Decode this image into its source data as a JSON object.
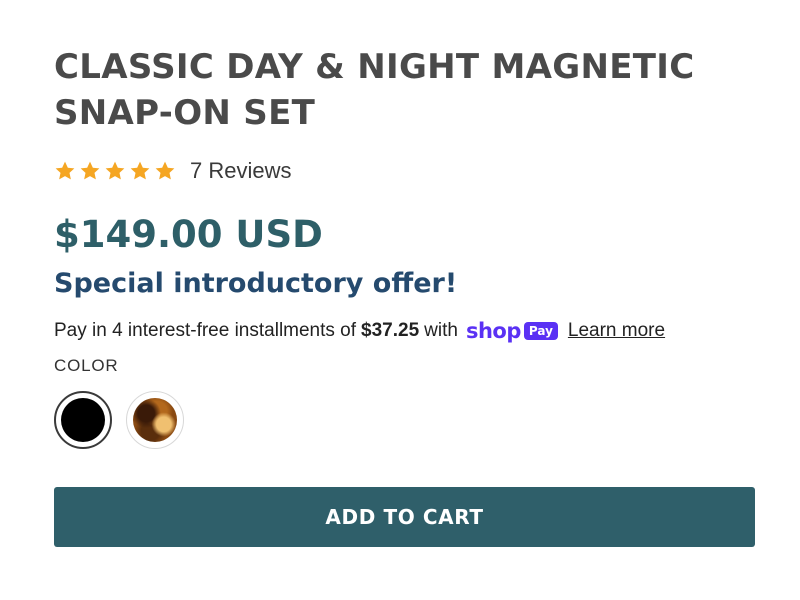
{
  "product": {
    "title": "CLASSIC DAY & NIGHT MAGNETIC SNAP-ON SET",
    "rating": 5,
    "rating_max": 5,
    "reviews_label": "7 Reviews",
    "price": "$149.00 USD",
    "promo": "Special introductory offer!"
  },
  "installments": {
    "prefix": "Pay in 4 interest-free installments of",
    "amount": "$37.25",
    "with": "with",
    "shop_word": "shop",
    "pay_badge": "Pay",
    "learn_more": "Learn more"
  },
  "color": {
    "label": "COLOR",
    "options": [
      {
        "name": "black",
        "selected": true,
        "color": "#000000"
      },
      {
        "name": "tortoise",
        "selected": false,
        "color": "#8a4a12"
      }
    ]
  },
  "cart": {
    "button_label": "ADD TO CART"
  },
  "colors": {
    "star": "#f5a623",
    "price": "#2e5f68",
    "promo": "#254a6e",
    "shop_pay": "#5a31f4",
    "button": "#2f5f6a"
  }
}
